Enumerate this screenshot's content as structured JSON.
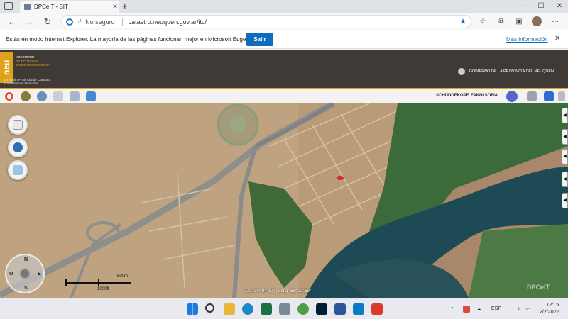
{
  "browser": {
    "tab_title": "DPCeIT - SIT",
    "tab_close": "✕",
    "new_tab": "+",
    "win_min": "—",
    "win_max": "☐",
    "win_close": "✕",
    "security_label": "No seguro",
    "url": "catastro.neuquen.gov.ar/itc/"
  },
  "infobar": {
    "message": "Estás en modo Internet Explorer. La mayoría de las páginas funcionan mejor en Microsoft Edge.",
    "exit_button": "Salir",
    "more_info": "Más información",
    "close": "✕"
  },
  "header": {
    "logo_mark": "neu",
    "logo_line1": "MINISTERIO",
    "logo_line2": "DE ECONOMÍA",
    "logo_line3": "E INFRAESTRUCTURA",
    "logo_sub1": "Dirección Provincial de Catastro",
    "logo_sub2": "e Información Territorial",
    "government": "GOBIERNO DE LA PROVINCIA DEL NEUQUÉN"
  },
  "toolbar": {
    "username": "SCHÜDDEKOPF, FANNI SOFIA"
  },
  "map": {
    "compass": {
      "n": "N",
      "s": "S",
      "e": "E",
      "o": "O"
    },
    "scale_top": "500m",
    "scale_bottom": "1000ft",
    "coordinates": "Lat -39° 04' 17\" ; Long -68° 32' 59\"",
    "watermark": "DPCeIT"
  },
  "taskbar": {
    "lang": "ESP",
    "time": "12:15",
    "date": "2/2/2022"
  },
  "colors": {
    "header_bg": "#403a37",
    "accent_gold": "#e0a21b",
    "edge_blue": "#0f6cbd"
  }
}
